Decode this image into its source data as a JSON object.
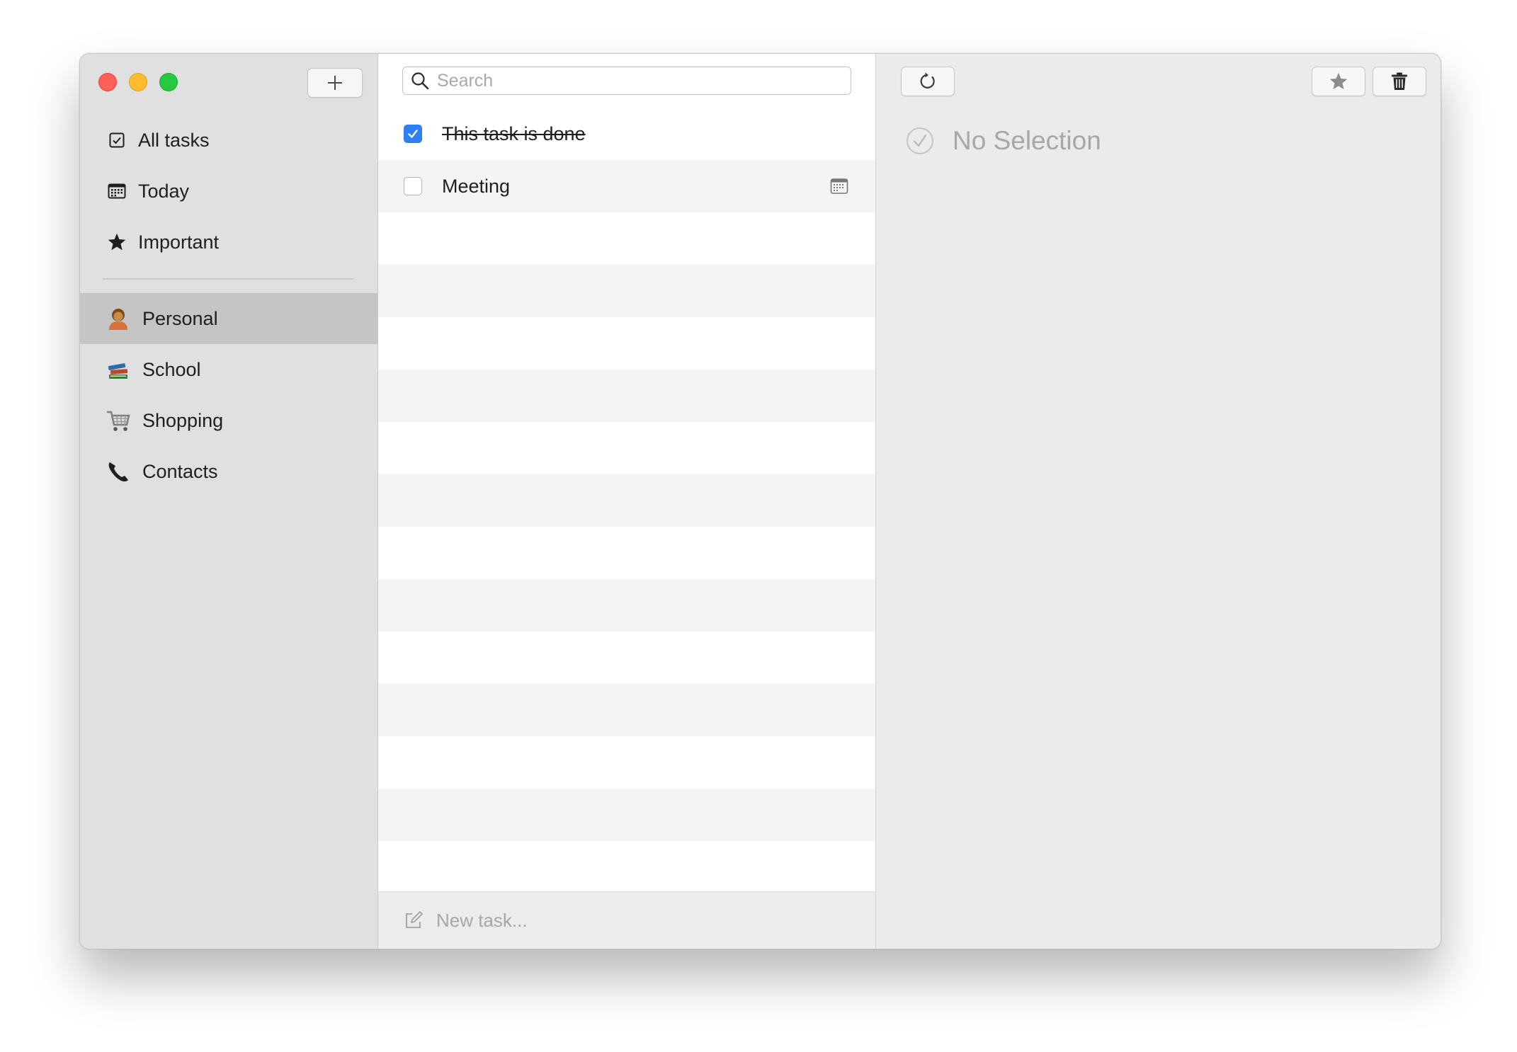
{
  "window": {
    "controls": [
      "close",
      "minimize",
      "zoom"
    ]
  },
  "sidebar": {
    "add_list_icon": "plus-icon",
    "smart_lists": [
      {
        "label": "All tasks",
        "icon": "checkbox-icon"
      },
      {
        "label": "Today",
        "icon": "calendar-icon"
      },
      {
        "label": "Important",
        "icon": "star-icon"
      }
    ],
    "lists": [
      {
        "label": "Personal",
        "icon": "person-emoji-icon",
        "selected": true
      },
      {
        "label": "School",
        "icon": "books-emoji-icon",
        "selected": false
      },
      {
        "label": "Shopping",
        "icon": "shopping-cart-emoji-icon",
        "selected": false
      },
      {
        "label": "Contacts",
        "icon": "telephone-emoji-icon",
        "selected": false
      }
    ]
  },
  "tasks": {
    "search": {
      "placeholder": "Search",
      "value": ""
    },
    "items": [
      {
        "title": "This task is done",
        "done": true,
        "has_due_date": false
      },
      {
        "title": "Meeting",
        "done": false,
        "has_due_date": true
      }
    ],
    "new_task": {
      "placeholder": "New task...",
      "value": ""
    }
  },
  "detail": {
    "empty_text": "No Selection",
    "toolbar": [
      "refresh-icon",
      "star-icon",
      "trash-icon"
    ]
  },
  "colors": {
    "accent": "#2f7ff6",
    "sidebar_bg": "#e0e0e0",
    "selected_row": "#c5c5c5",
    "close": "#fe5f57",
    "minimize": "#febc2e",
    "zoom": "#28c840"
  }
}
